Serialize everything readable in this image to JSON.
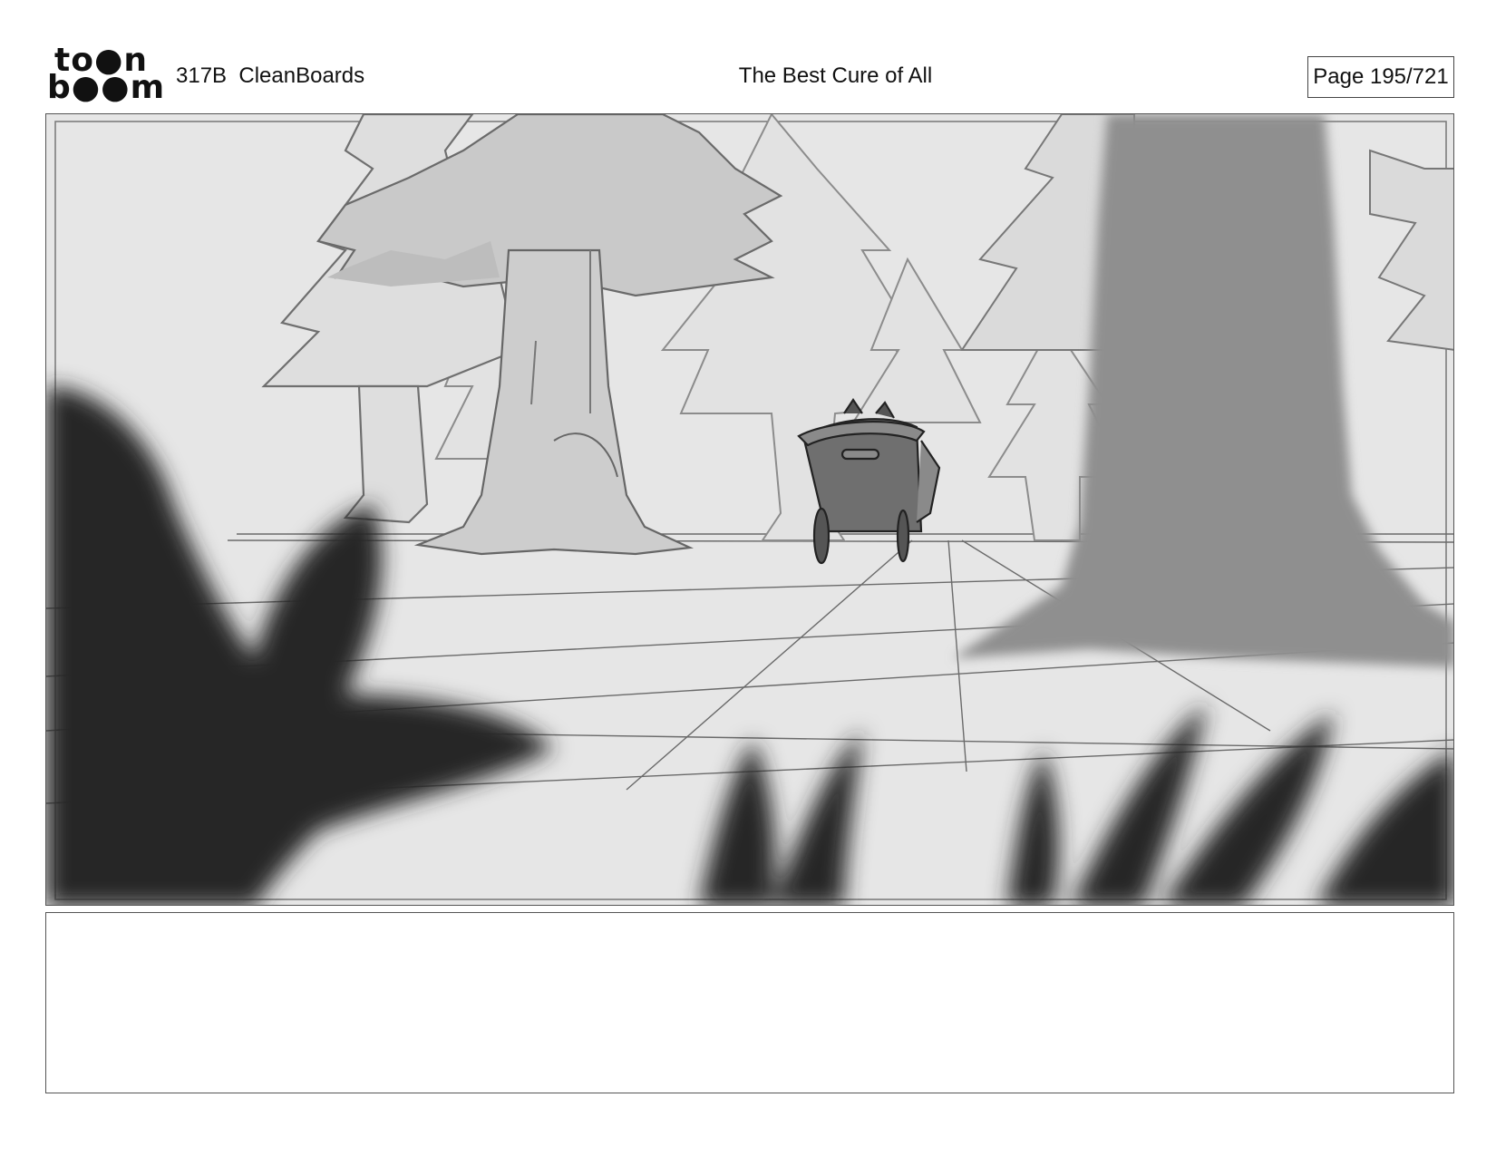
{
  "header": {
    "logo_line1": "to●n",
    "logo_line2": "b●●m",
    "episode": "317B  CleanBoards",
    "title": "The Best Cure of All",
    "page": "Page 195/721"
  },
  "panel": {
    "notes": ""
  }
}
